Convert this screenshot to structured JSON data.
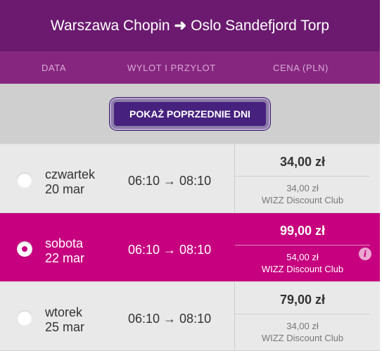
{
  "route": {
    "origin": "Warszawa Chopin",
    "arrow": "➜",
    "destination": "Oslo Sandefjord Torp"
  },
  "columns": {
    "date": "DATA",
    "times": "WYLOT I PRZYLOT",
    "price": "CENA (PLN)"
  },
  "prev_days_label": "POKAŻ POPRZEDNIE DNI",
  "flights": [
    {
      "weekday": "czwartek",
      "date": "20 mar",
      "times": "06:10 → 08:10",
      "price": "34,00 zł",
      "club_price": "34,00 zł",
      "club_name": "WIZZ Discount Club",
      "selected": false
    },
    {
      "weekday": "sobota",
      "date": "22 mar",
      "times": "06:10 → 08:10",
      "price": "99,00 zł",
      "club_price": "54,00 zł",
      "club_name": "WIZZ Discount Club",
      "selected": true
    },
    {
      "weekday": "wtorek",
      "date": "25 mar",
      "times": "06:10 → 08:10",
      "price": "79,00 zł",
      "club_price": "34,00 zł",
      "club_name": "WIZZ Discount Club",
      "selected": false
    }
  ],
  "colors": {
    "header": "#6b1a6f",
    "subheader": "#86267f",
    "button": "#46217e",
    "selected_row": "#c6007e"
  }
}
